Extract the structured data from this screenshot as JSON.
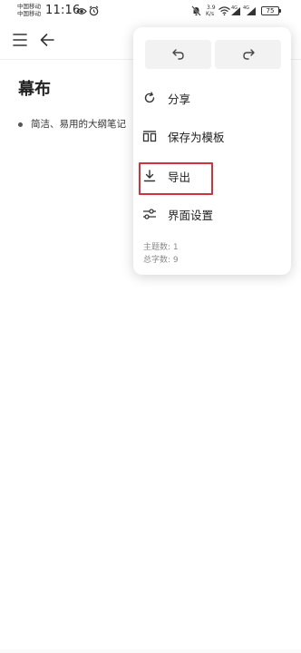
{
  "status_bar": {
    "carrier_1": "中国移动",
    "carrier_2": "中国移动",
    "time": "11:16",
    "speed_value": "3.9",
    "speed_unit": "K/s",
    "network_1": "4G",
    "network_2": "4G",
    "battery": "75",
    "icons": [
      "eye-icon",
      "alarm-icon",
      "mute-icon",
      "wifi-icon",
      "signal-icon",
      "signal-icon"
    ]
  },
  "app_bar": {
    "icons": [
      "menu-icon",
      "back-arrow-icon"
    ]
  },
  "document": {
    "title": "幕布",
    "items": [
      {
        "text": "简洁、易用的大纲笔记"
      }
    ]
  },
  "popup_menu": {
    "icons": [
      "undo-icon",
      "redo-icon"
    ],
    "items": [
      {
        "label": "分享",
        "icon": "share-icon"
      },
      {
        "label": "保存为模板",
        "icon": "template-icon"
      },
      {
        "label": "导出",
        "icon": "export-icon"
      },
      {
        "label": "界面设置",
        "icon": "settings-sliders-icon"
      }
    ],
    "stats": {
      "topics": "主题数: 1",
      "chars": "总字数: 9"
    },
    "highlight_color": "#d2323f"
  }
}
